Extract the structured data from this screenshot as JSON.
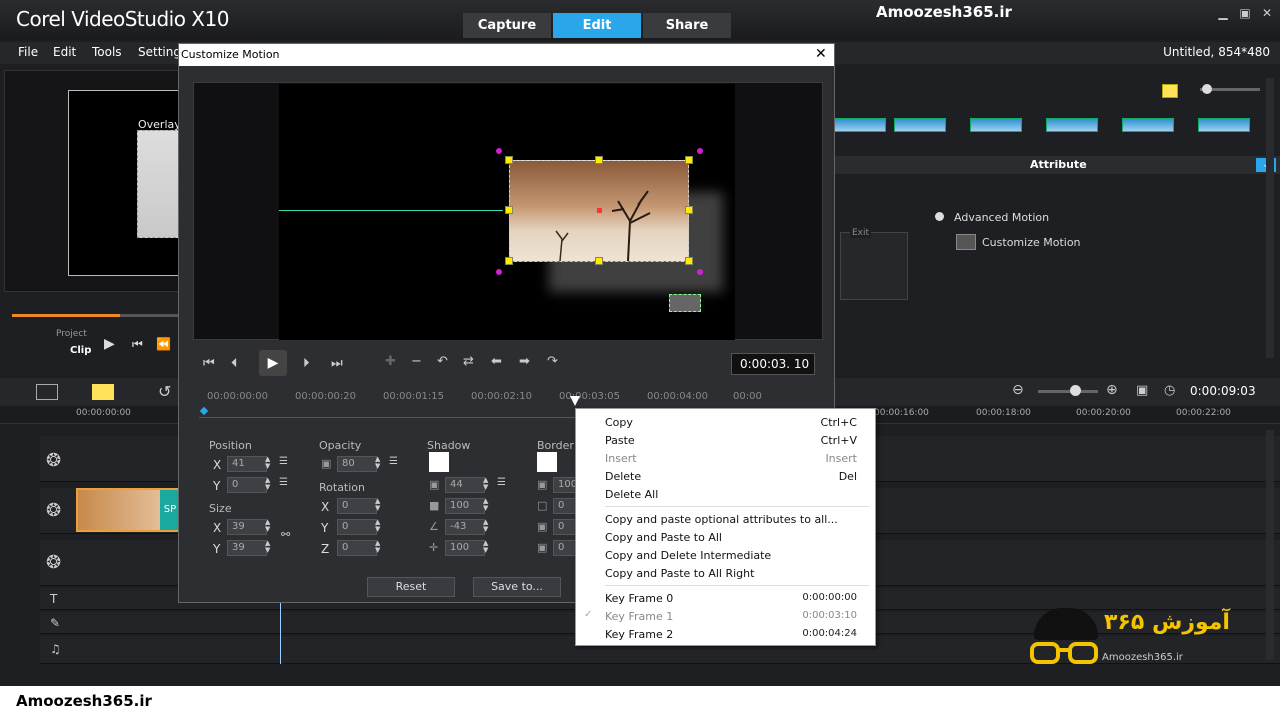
{
  "app": {
    "brand": "Corel VideoStudio X10",
    "tabs": [
      "Capture",
      "Edit",
      "Share"
    ],
    "active_tab": "Edit",
    "watermark_top": "Amoozesh365.ir",
    "menu": [
      "File",
      "Edit",
      "Tools",
      "Settings"
    ],
    "project_info": "Untitled, 854*480"
  },
  "preview": {
    "overlay_label": "Overlay",
    "project_label": "Project",
    "clip_label": "Clip"
  },
  "right_panel": {
    "attribute_label": "Attribute",
    "advanced_motion": "Advanced Motion",
    "customize_motion": "Customize Motion",
    "exit_label": "Exit"
  },
  "timeline": {
    "start_time": "00:00:00:00",
    "ticks": [
      "00:00:16:00",
      "00:00:18:00",
      "00:00:20:00",
      "00:00:22:00"
    ],
    "current_time": "0:00:09:03",
    "clip_label": "SP"
  },
  "dialog": {
    "title": "Customize Motion",
    "timecode": "0:00:03. 10",
    "ruler": [
      "00:00:00:00",
      "00:00:00:20",
      "00:00:01:15",
      "00:00:02:10",
      "00:00:03:05",
      "00:00:04:00",
      "00:00"
    ],
    "position": {
      "label": "Position",
      "x": "41",
      "y": "0"
    },
    "size": {
      "label": "Size",
      "x": "39",
      "y": "39"
    },
    "opacity": {
      "label": "Opacity",
      "value": "80"
    },
    "rotation": {
      "label": "Rotation",
      "x": "0",
      "y": "0",
      "z": "0"
    },
    "shadow": {
      "label": "Shadow",
      "a": "44",
      "b": "100",
      "c": "-43",
      "d": "100"
    },
    "border": {
      "label": "Border",
      "a": "100",
      "b": "0",
      "c": "0",
      "d": "0"
    },
    "axes": {
      "x": "X",
      "y": "Y",
      "z": "Z"
    },
    "reset": "Reset",
    "save_to": "Save to..."
  },
  "context_menu": {
    "items": [
      {
        "label": "Copy",
        "shortcut": "Ctrl+C",
        "disabled": false
      },
      {
        "label": "Paste",
        "shortcut": "Ctrl+V",
        "disabled": false
      },
      {
        "label": "Insert",
        "shortcut": "Insert",
        "disabled": true
      },
      {
        "label": "Delete",
        "shortcut": "Del",
        "disabled": false
      },
      {
        "label": "Delete All",
        "shortcut": "",
        "disabled": false
      }
    ],
    "copy_items": [
      "Copy and paste optional attributes to all...",
      "Copy and Paste to All",
      "Copy and Delete Intermediate",
      "Copy and Paste to All Right"
    ],
    "keyframes": [
      {
        "label": "Key   Frame  0",
        "time": "0:00:00:00",
        "disabled": false
      },
      {
        "label": "Key   Frame  1",
        "time": "0:00:03:10",
        "disabled": true
      },
      {
        "label": "Key   Frame  2",
        "time": "0:00:04:24",
        "disabled": false
      }
    ]
  },
  "footer": {
    "watermark": "Amoozesh365.ir",
    "logo_text": "Amoozesh365.ir",
    "logo_persian": "آموزش ۳۶۵"
  }
}
